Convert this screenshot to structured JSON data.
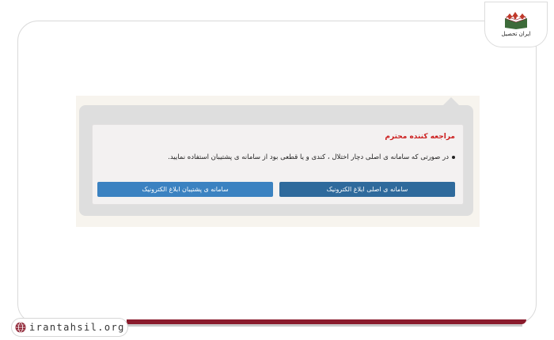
{
  "watermark": {
    "site_url": "irantahsil.org",
    "logo_text": "ایران تحصیل"
  },
  "notice": {
    "title": "مراجعه کننده محترم",
    "message": "در صورتی که سامانه ی اصلی دچار اختلال ، کندی و یا قطعی بود از سامانه ی پشتیبان استفاده نمایید.",
    "primary_button_label": "سامانه ی اصلی ابلاغ الکترونیک",
    "secondary_button_label": "سامانه ی پشتیبان ابلاغ الکترونیک"
  },
  "colors": {
    "title": "#cc1f1f",
    "primary_button": "#2f6a9c",
    "secondary_button": "#3b82c1",
    "brand": "#8a1b2c"
  }
}
